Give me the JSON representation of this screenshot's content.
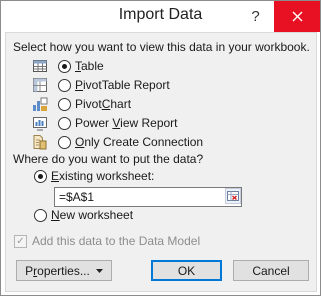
{
  "window": {
    "title": "Import Data",
    "help_glyph": "?"
  },
  "view_section": {
    "heading": "Select how you want to view this data in your workbook.",
    "options": [
      {
        "pre": "",
        "key": "T",
        "post": "able",
        "icon": "table-icon",
        "selected": true
      },
      {
        "pre": "",
        "key": "P",
        "post": "ivotTable Report",
        "icon": "pivottable-icon",
        "selected": false
      },
      {
        "pre": "Pivot",
        "key": "C",
        "post": "hart",
        "icon": "pivotchart-icon",
        "selected": false
      },
      {
        "pre": "Power ",
        "key": "V",
        "post": "iew Report",
        "icon": "power-view-icon",
        "selected": false
      },
      {
        "pre": "",
        "key": "O",
        "post": "nly Create Connection",
        "icon": "connection-icon",
        "selected": false
      }
    ]
  },
  "location_section": {
    "heading": "Where do you want to put the data?",
    "existing_pre": "",
    "existing_key": "E",
    "existing_post": "xisting worksheet:",
    "existing_selected": true,
    "range_value": "=$A$1",
    "new_pre": "",
    "new_key": "N",
    "new_post": "ew worksheet",
    "new_selected": false
  },
  "data_model": {
    "label": "Add this data to the Data Model",
    "checked": true,
    "disabled": true
  },
  "buttons": {
    "properties_pre": "P",
    "properties_key": "r",
    "properties_post": "operties...",
    "ok": "OK",
    "cancel": "Cancel"
  }
}
